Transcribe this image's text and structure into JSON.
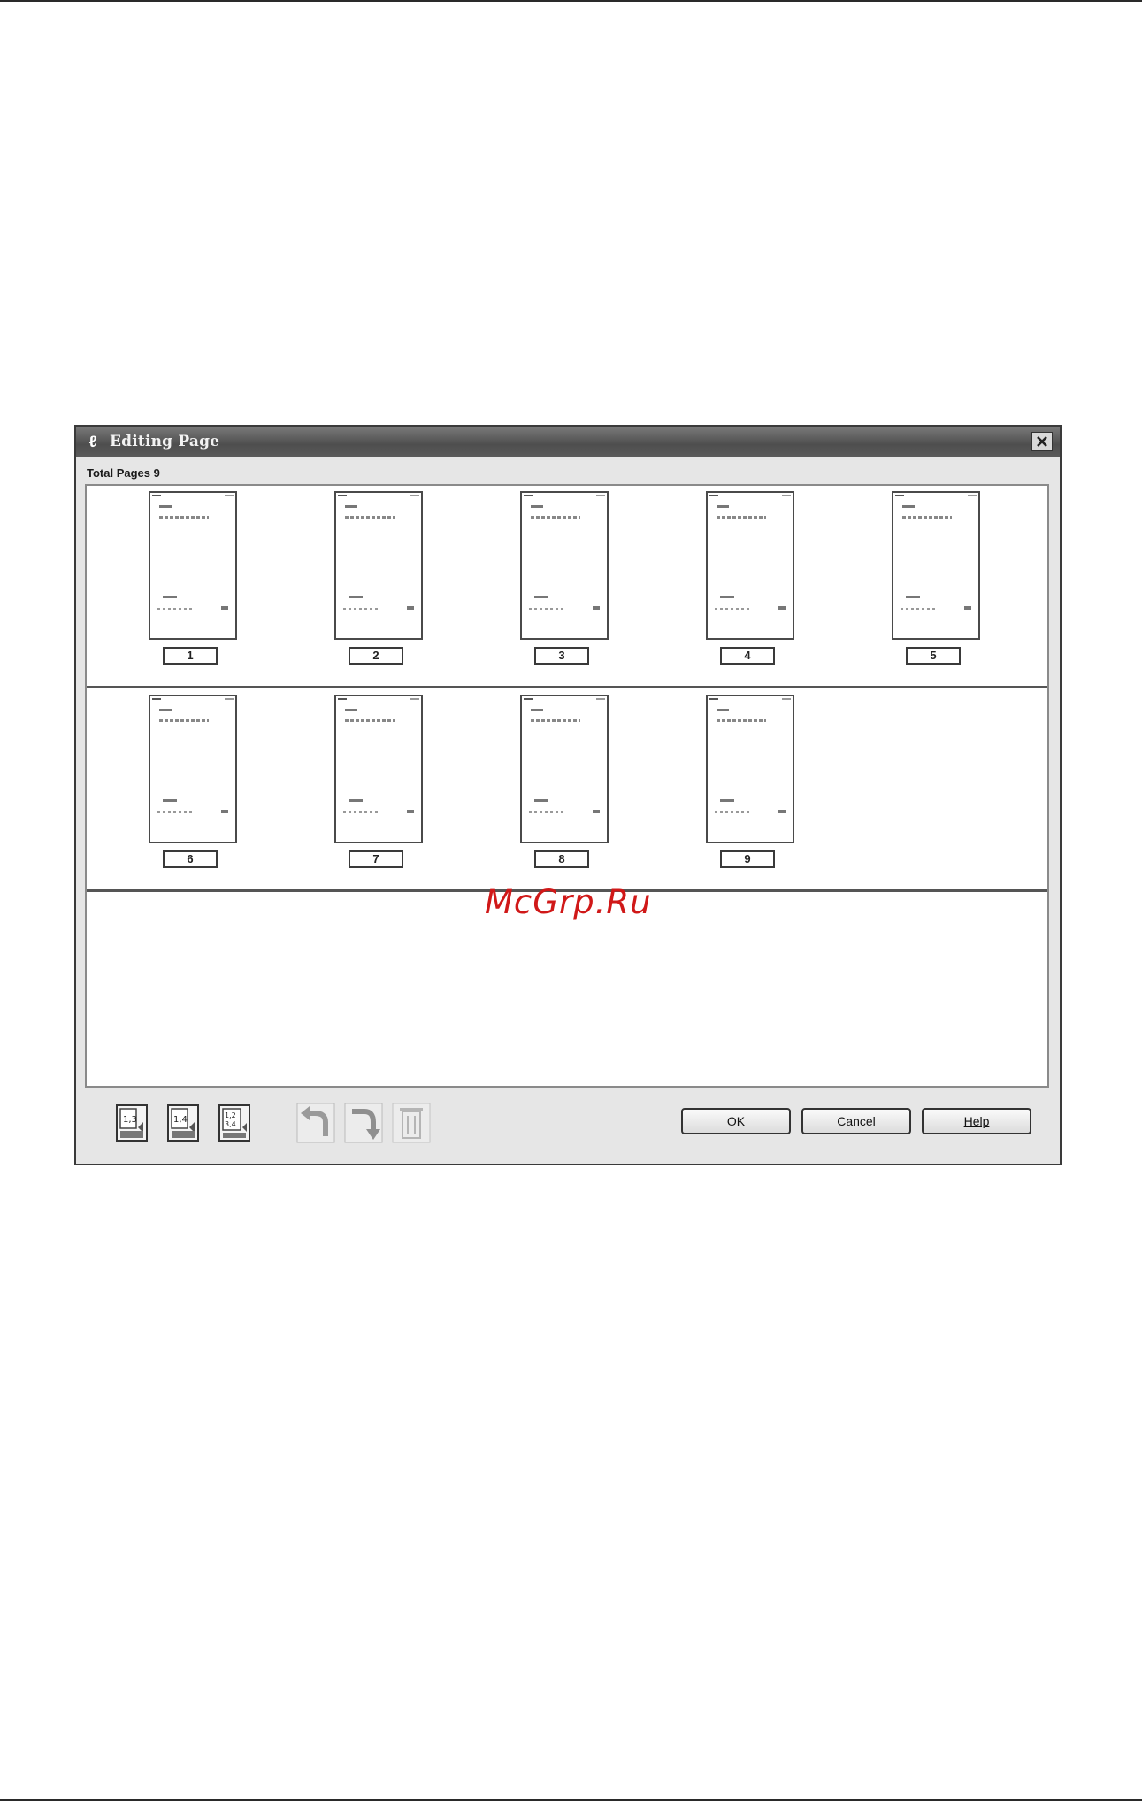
{
  "dialog": {
    "title": "Editing Page",
    "total_pages_label": "Total Pages 9",
    "pages": [
      "1",
      "2",
      "3",
      "4",
      "5",
      "6",
      "7",
      "8",
      "9"
    ],
    "buttons": {
      "ok": "OK",
      "cancel": "Cancel",
      "help": "Help"
    },
    "toolbar_icons": [
      "layout-1-3-icon",
      "layout-1-4-icon",
      "layout-1-2-3-4-icon",
      "rotate-left-icon",
      "rotate-right-icon",
      "delete-icon"
    ]
  },
  "watermark": "McGrp.Ru",
  "colors": {
    "titlebar": "#5a5a5a",
    "watermark": "#d01818",
    "dialog_bg": "#e6e6e6"
  }
}
